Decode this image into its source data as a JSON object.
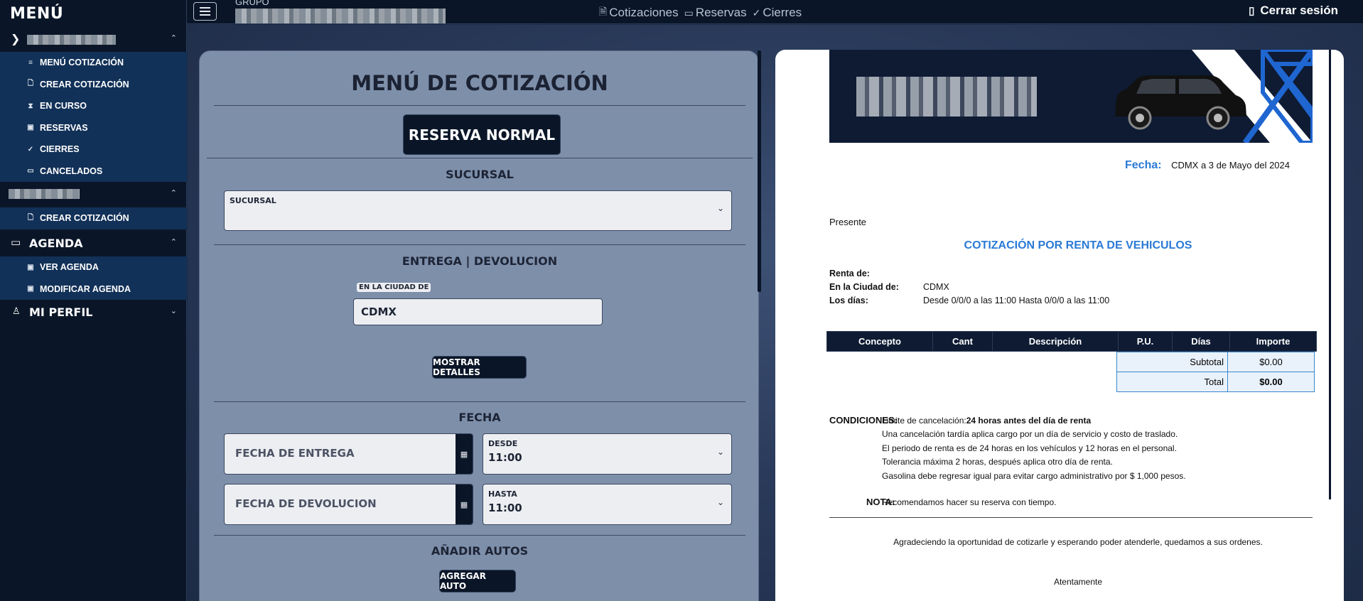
{
  "sidebar": {
    "title": "MENÚ",
    "group1_items": [
      {
        "icon": "list-icon",
        "glyph": "≡",
        "label": "MENÚ COTIZACIÓN"
      },
      {
        "icon": "document-plus-icon",
        "glyph": "🗋",
        "label": "CREAR COTIZACIÓN"
      },
      {
        "icon": "hourglass-icon",
        "glyph": "⧗",
        "label": "EN CURSO"
      },
      {
        "icon": "calendar-icon",
        "glyph": "▣",
        "label": "RESERVAS"
      },
      {
        "icon": "check-circle-icon",
        "glyph": "✓",
        "label": "CIERRES"
      },
      {
        "icon": "archive-icon",
        "glyph": "▭",
        "label": "CANCELADOS"
      }
    ],
    "group2_items": [
      {
        "icon": "document-plus-icon",
        "glyph": "🗋",
        "label": "CREAR COTIZACIÓN"
      }
    ],
    "agenda_label": "AGENDA",
    "agenda_items": [
      {
        "icon": "calendar-check-icon",
        "glyph": "▣",
        "label": "VER AGENDA"
      },
      {
        "icon": "calendar-edit-icon",
        "glyph": "▣",
        "label": "MODIFICAR AGENDA"
      }
    ],
    "perfil_label": "MI PERFIL"
  },
  "topbar": {
    "grupo_label": "GRUPO",
    "nav": [
      {
        "icon": "document-icon",
        "glyph": "🗎",
        "label": "Cotizaciones"
      },
      {
        "icon": "window-icon",
        "glyph": "▭",
        "label": "Reservas"
      },
      {
        "icon": "check-circle-icon",
        "glyph": "✓",
        "label": "Cierres"
      }
    ],
    "logout_label": "Cerrar sesión"
  },
  "form": {
    "title": "MENÚ DE COTIZACIÓN",
    "reserva_button": "RESERVA NORMAL",
    "sucursal_section": "SUCURSAL",
    "sucursal_select_label": "SUCURSAL",
    "entrega_section": "ENTREGA | DEVOLUCION",
    "ciudad_label": "EN LA CIUDAD DE",
    "ciudad_value": "CDMX",
    "details_button": "MOSTRAR DETALLES",
    "fecha_section": "FECHA",
    "fecha_entrega_placeholder": "FECHA DE ENTREGA",
    "desde_label": "DESDE",
    "desde_value": "11:00",
    "fecha_devolucion_placeholder": "FECHA DE DEVOLUCION",
    "hasta_label": "HASTA",
    "hasta_value": "11:00",
    "autos_section": "AÑADIR AUTOS",
    "add_car_button": "AGREGAR AUTO"
  },
  "document": {
    "fecha_label": "Fecha:",
    "fecha_value": "CDMX a 3 de Mayo del 2024",
    "presente": "Presente",
    "title": "COTIZACIÓN POR RENTA DE VEHICULOS",
    "renta_label": "Renta de:",
    "ciudad_label": "En la Ciudad de:",
    "ciudad_value": "CDMX",
    "dias_label": "Los días:",
    "dias_value": "Desde 0/0/0 a las 11:00 Hasta 0/0/0 a las 11:00",
    "table_headers": [
      "Concepto",
      "Cant",
      "Descripción",
      "P.U.",
      "Días",
      "Importe"
    ],
    "subtotal_label": "Subtotal",
    "subtotal_value": "$0.00",
    "total_label": "Total",
    "total_value": "$0.00",
    "condiciones_label": "CONDICIONES:",
    "cancel_prefix": "Limite de cancelación:",
    "cancel_bold": "24 horas antes del día de renta",
    "conditions": [
      "Una cancelación tardía aplica cargo por un día de servicio y costo de traslado.",
      "El periodo de renta es de 24 horas en los vehículos y 12 horas en el personal.",
      "Tolerancia máxima 2 horas, después aplica otro día de renta.",
      "Gasolina debe regresar igual para evitar cargo administrativo por $ 1,000 pesos."
    ],
    "nota_label": "NOTA:",
    "nota_value": "Recomendamos hacer su reserva con tiempo.",
    "closing": "Agradeciendo  la  oportunidad  de  cotizarle  y  esperando poder atenderle,  quedamos a sus ordenes.",
    "signoff": "Atentamente"
  },
  "colors": {
    "navy": "#0a1628",
    "sidebar_active": "#123158",
    "panel": "#7e8faa",
    "accent_blue": "#2a7ad6"
  }
}
